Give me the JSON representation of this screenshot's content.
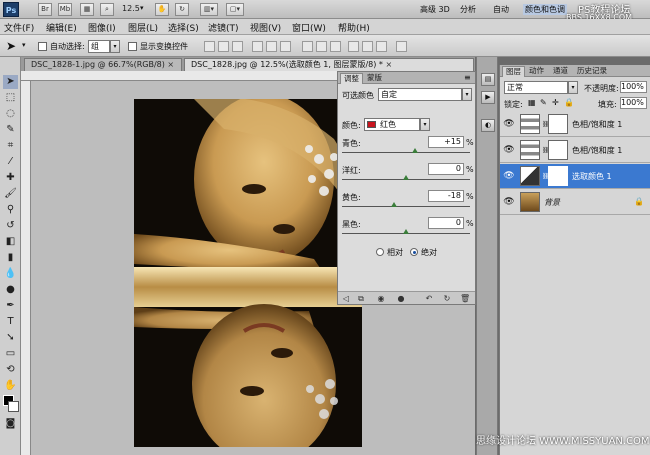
{
  "app": {
    "logo": "Ps",
    "zoom_value": "12.5",
    "workspaces": [
      "高级 3D",
      "分析",
      "自动",
      "颜色和色调"
    ],
    "watermark_top": "PS教程论坛",
    "watermark_top_sub": "BBS.16XX8.COM",
    "watermark_bottom": "思缘设计论坛 WWW.MISSYUAN.COM"
  },
  "menu": [
    "文件(F)",
    "编辑(E)",
    "图像(I)",
    "图层(L)",
    "选择(S)",
    "滤镜(T)",
    "视图(V)",
    "窗口(W)",
    "帮助(H)"
  ],
  "options": {
    "auto_select_label": "自动选择:",
    "auto_select_value": "组",
    "show_transform_label": "显示变换控件"
  },
  "tabs": [
    {
      "label": "DSC_1828-1.jpg @ 66.7%(RGB/8)"
    },
    {
      "label": "DSC_1828.jpg @ 12.5%(选取颜色 1, 图层蒙版/8) *"
    }
  ],
  "adjustments": {
    "tab_adjust": "调整",
    "tab_mask": "蒙版",
    "preset_title": "可选颜色",
    "preset_value": "自定",
    "color_label": "颜色:",
    "color_value": "红色",
    "color_swatch": "#c8141e",
    "sliders": [
      {
        "label": "青色:",
        "value": "+15",
        "unit": "%",
        "level": 0.57
      },
      {
        "label": "洋红:",
        "value": "0",
        "unit": "%",
        "level": 0.5
      },
      {
        "label": "黄色:",
        "value": "-18",
        "unit": "%",
        "level": 0.41
      },
      {
        "label": "黑色:",
        "value": "0",
        "unit": "%",
        "level": 0.5
      }
    ],
    "method_relative": "相对",
    "method_absolute": "绝对"
  },
  "layers_panel": {
    "tabs": [
      "图层",
      "动作",
      "通道",
      "历史记录"
    ],
    "blend_mode": "正常",
    "opacity_label": "不透明度:",
    "opacity_value": "100%",
    "lock_label": "锁定:",
    "fill_label": "填充:",
    "fill_value": "100%",
    "layers": [
      {
        "name": "色相/饱和度 1",
        "selected": false
      },
      {
        "name": "色相/饱和度 1",
        "selected": false
      },
      {
        "name": "选取颜色 1",
        "selected": true
      },
      {
        "name": "背景",
        "selected": false
      }
    ]
  },
  "colors": {
    "selection": "#3b79d0",
    "photo_gold": "#c9a05a"
  }
}
